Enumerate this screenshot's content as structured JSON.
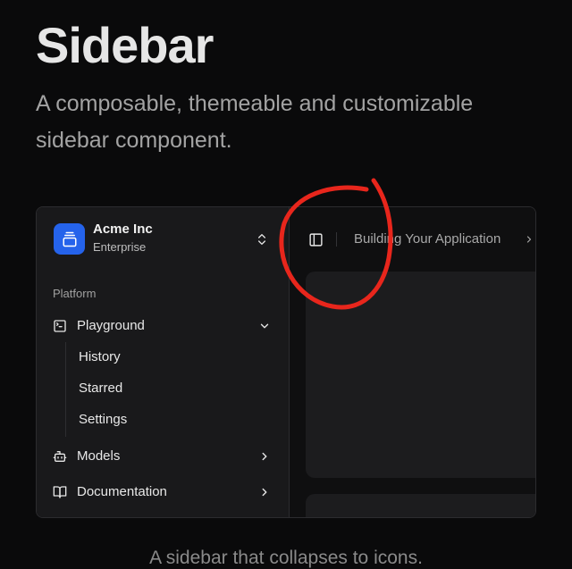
{
  "page": {
    "title": "Sidebar",
    "subtitle": "A composable, themeable and customizable sidebar component.",
    "caption": "A sidebar that collapses to icons."
  },
  "sidebar": {
    "team": {
      "name": "Acme Inc",
      "plan": "Enterprise",
      "logo_icon": "gallery-vertical-end-icon",
      "switcher_icon": "chevrons-up-down-icon"
    },
    "group_label": "Platform",
    "items": [
      {
        "label": "Playground",
        "icon": "square-terminal-icon",
        "expanded": true,
        "subitems": [
          "History",
          "Starred",
          "Settings"
        ]
      },
      {
        "label": "Models",
        "icon": "bot-icon",
        "expanded": false
      },
      {
        "label": "Documentation",
        "icon": "book-open-icon",
        "expanded": false
      }
    ]
  },
  "header": {
    "toggle_icon": "panel-left-icon",
    "breadcrumb": "Building Your Application",
    "breadcrumb_separator_icon": "chevron-right-icon"
  },
  "colors": {
    "background": "#0a0a0b",
    "sidebar": "#19191b",
    "card": "#1c1c1e",
    "accent": "#2563eb",
    "annotation": "#e8261c"
  }
}
